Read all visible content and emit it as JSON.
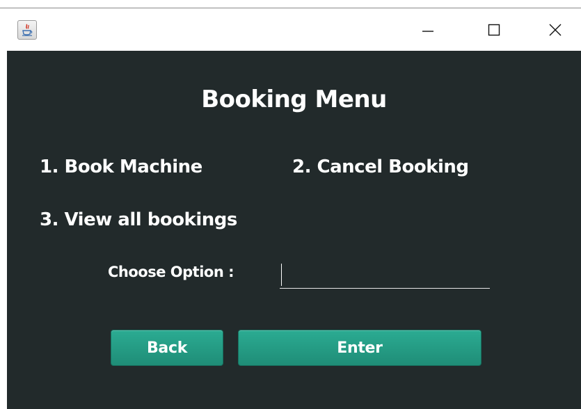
{
  "window": {
    "controls": {
      "minimize_icon": "minimize-icon",
      "maximize_icon": "maximize-icon",
      "close_icon": "close-icon"
    },
    "app_icon": "java-icon"
  },
  "menu": {
    "title": "Booking Menu",
    "options": [
      "1. Book Machine",
      "2. Cancel Booking",
      "3. View all bookings"
    ]
  },
  "form": {
    "choose_label": "Choose Option :",
    "option_value": "",
    "option_placeholder": ""
  },
  "buttons": {
    "back_label": "Back",
    "enter_label": "Enter"
  },
  "colors": {
    "panel_background": "#222a2b",
    "button": "#26a08a",
    "text": "#ffffff"
  }
}
